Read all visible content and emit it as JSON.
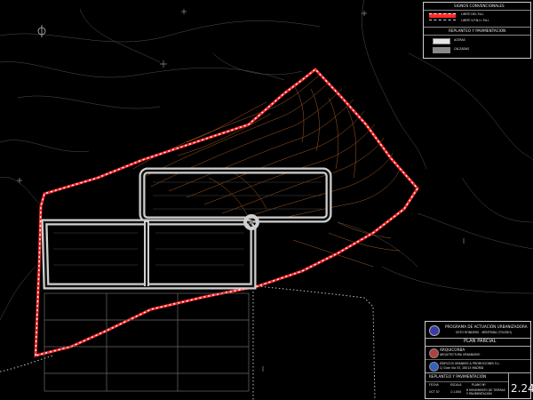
{
  "legend": {
    "title": "SIGNOS CONVENCIONALES",
    "item1_label": "LIMITE DEL P.A.I.",
    "item2_label": "LIMITE S.P.N.U. P.A.I.",
    "section_title": "REPLANTEO Y PAVIMENTACION",
    "pav1_label": "ACERAS",
    "pav2_label": "CALZADAS",
    "limit_color": "#ff2a2a",
    "road_color": "#cfcfcf"
  },
  "title_block": {
    "program_line1": "PROGRAMA DE ACTUACIÓN URBANIZADORA",
    "program_line2": "SOTO RONDERO - MÉNTRIDA (TOLEDO)",
    "doc_type": "PLAN PARCIAL",
    "author_firm": "ARQUICORBA",
    "author_sub": "ARQUITECTURA URBANISMO",
    "client_name": "EDIFICIOS GRANDES & PROMOCIONES S.L.",
    "client_sub": "C/ Gran Vía 53, 28013 MADRID",
    "plan_title": "REPLANTEO Y PAVIMENTACIÓN",
    "sheet_number": "2.24",
    "date_label": "OCT 07",
    "scale_label": "1:1.000",
    "notes_label": "6 MOVIMIENTO DE TIERRAS Y PAVIMENTACIÓN",
    "small_rows": [
      "FECHA",
      "ESCALA",
      "PLANO Nº"
    ]
  },
  "map": {
    "icons": [
      "north-arrow-icon",
      "roundabout-icon"
    ]
  }
}
